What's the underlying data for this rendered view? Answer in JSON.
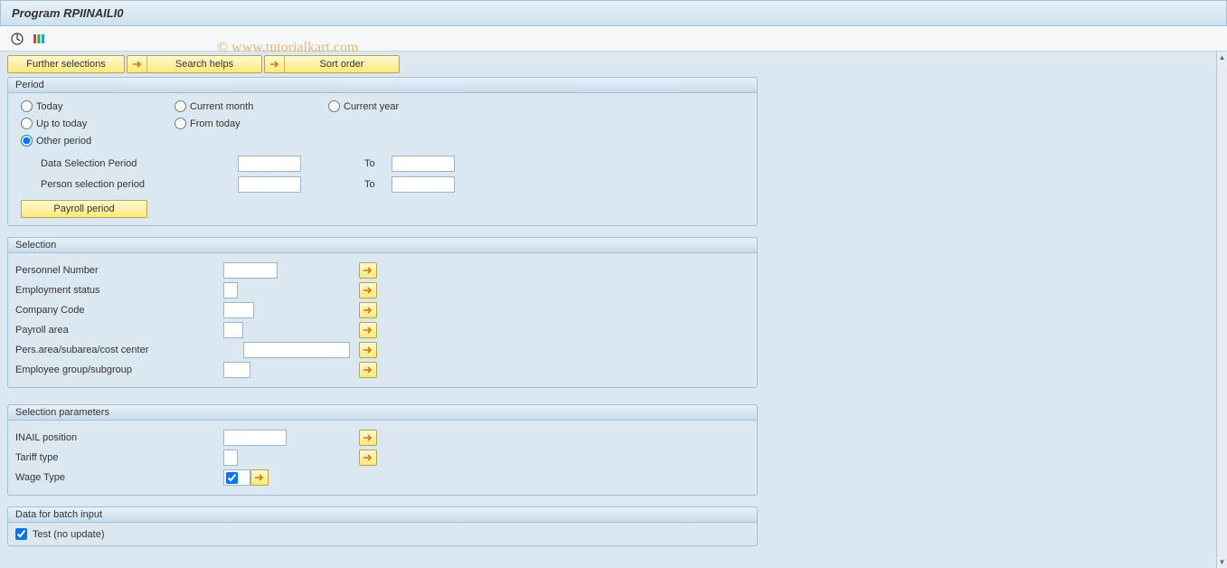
{
  "header": {
    "title": "Program RPIINAILI0"
  },
  "watermark": "© www.tutorialkart.com",
  "action_bar": {
    "further_selections": "Further selections",
    "search_helps": "Search helps",
    "sort_order": "Sort order"
  },
  "period_box": {
    "title": "Period",
    "radios": {
      "today": "Today",
      "current_month": "Current month",
      "current_year": "Current year",
      "up_to_today": "Up to today",
      "from_today": "From today",
      "other_period": "Other period"
    },
    "data_sel_label": "Data Selection Period",
    "person_sel_label": "Person selection period",
    "to_label": "To",
    "payroll_btn": "Payroll period"
  },
  "selection_box": {
    "title": "Selection",
    "personnel_number": "Personnel Number",
    "employment_status": "Employment status",
    "company_code": "Company Code",
    "payroll_area": "Payroll area",
    "pers_area": "Pers.area/subarea/cost center",
    "employee_group": "Employee group/subgroup"
  },
  "params_box": {
    "title": "Selection parameters",
    "inail_position": "INAIL position",
    "tariff_type": "Tariff type",
    "wage_type": "Wage Type"
  },
  "batch_box": {
    "title": "Data for batch input",
    "test_label": "Test (no update)"
  }
}
